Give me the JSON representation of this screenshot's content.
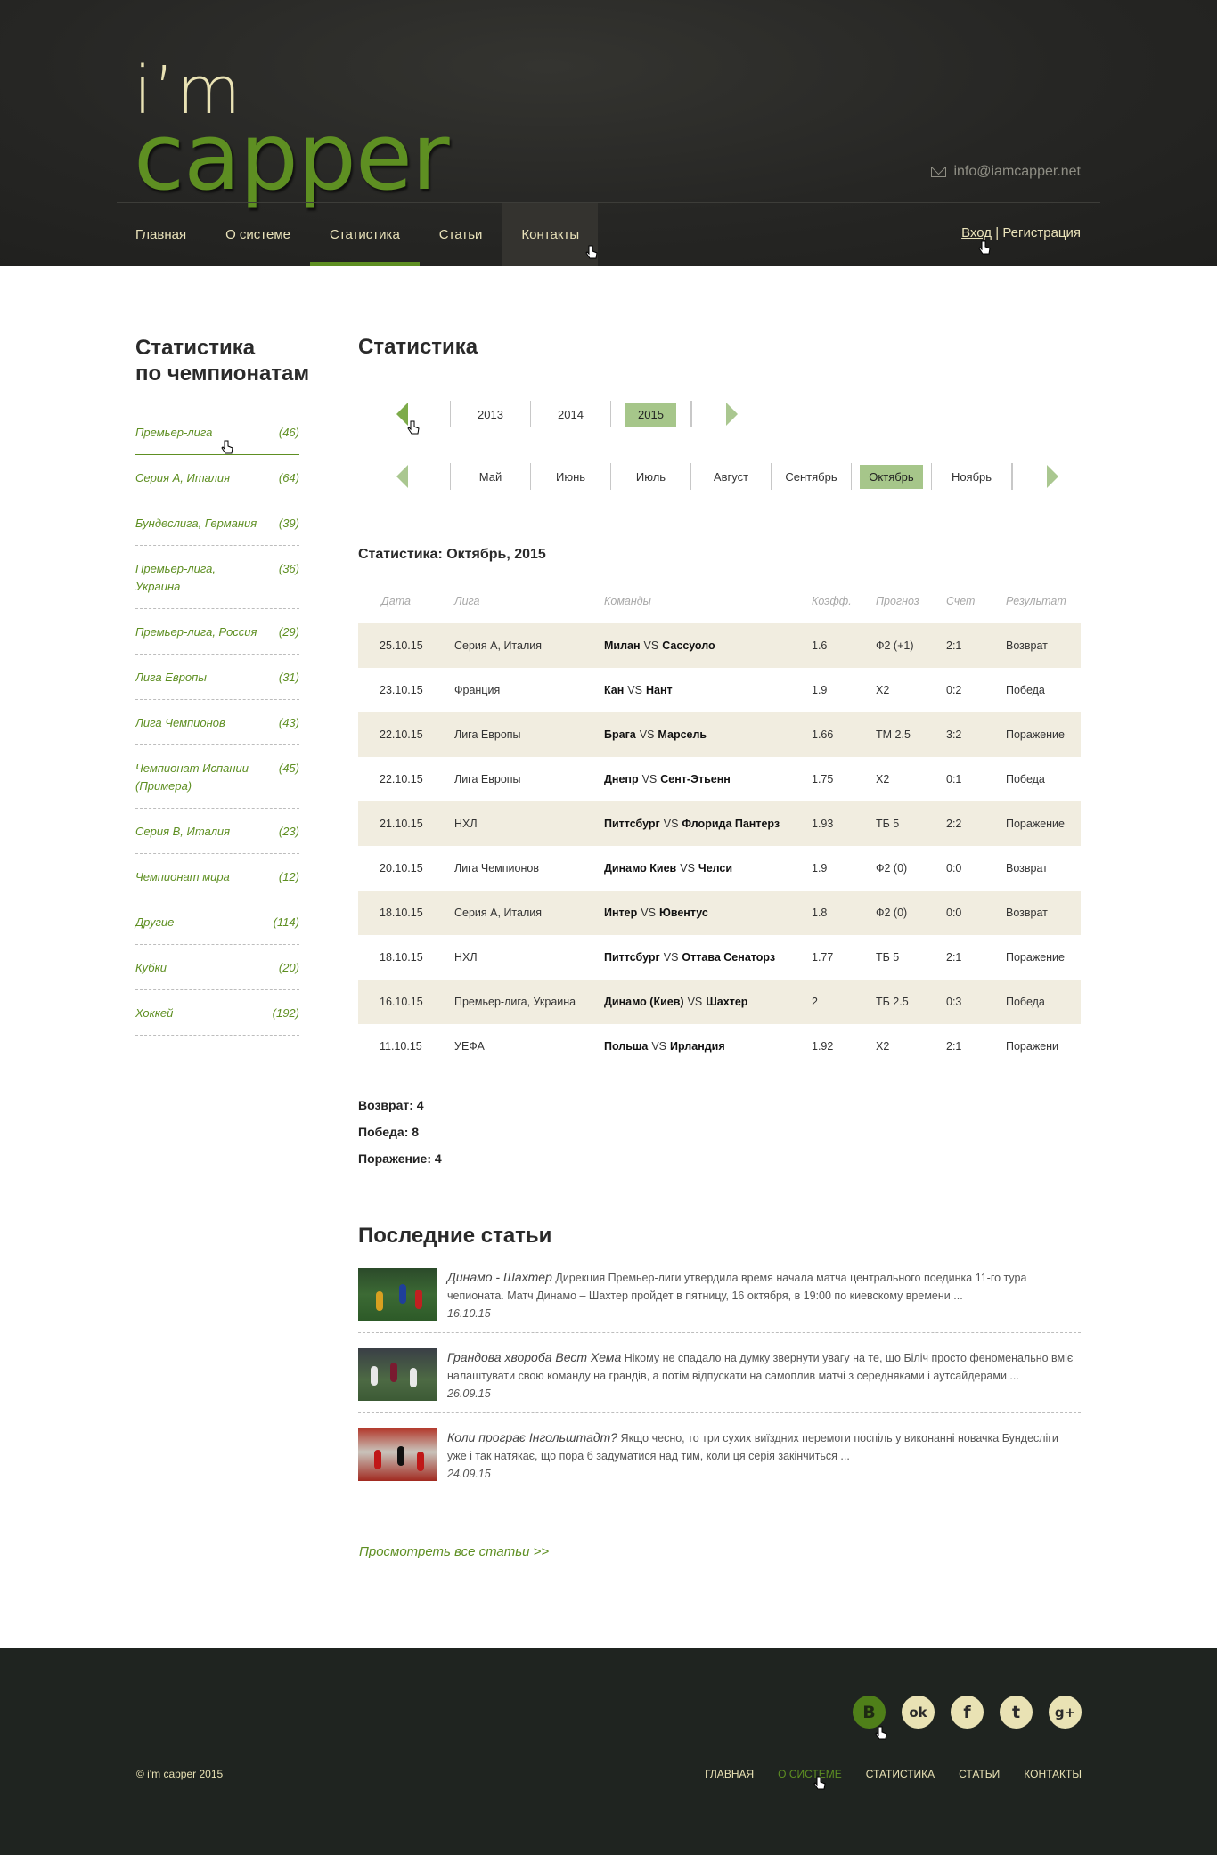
{
  "header": {
    "logo_top": "i’m",
    "logo_bottom": "capper",
    "email": "info@iamcapper.net",
    "nav": [
      "Главная",
      "О системе",
      "Статистика",
      "Статьи",
      "Контакты"
    ],
    "login": "Вход",
    "separator": "|",
    "register": "Регистрация"
  },
  "sidebar": {
    "title_line1": "Статистика",
    "title_line2": "по чемпионатам",
    "items": [
      {
        "name": "Премьер-лига",
        "count": "(46)"
      },
      {
        "name": "Серия А, Италия",
        "count": "(64)"
      },
      {
        "name": "Бундеслига, Германия",
        "count": "(39)"
      },
      {
        "name": "Премьер-лига, Украина",
        "count": "(36)"
      },
      {
        "name": "Премьер-лига, Россия",
        "count": "(29)"
      },
      {
        "name": "Лига Европы",
        "count": "(31)"
      },
      {
        "name": "Лига Чемпионов",
        "count": "(43)"
      },
      {
        "name": "Чемпионат Испании (Примера)",
        "count": "(45)"
      },
      {
        "name": "Серия В, Италия",
        "count": "(23)"
      },
      {
        "name": "Чемпионат мира",
        "count": "(12)"
      },
      {
        "name": "Другие",
        "count": "(114)"
      },
      {
        "name": "Кубки",
        "count": "(20)"
      },
      {
        "name": "Хоккей",
        "count": "(192)"
      }
    ]
  },
  "main": {
    "title": "Статистика",
    "years": [
      "2013",
      "2014",
      "2015"
    ],
    "selected_year": "2015",
    "months": [
      "Май",
      "Июнь",
      "Июль",
      "Август",
      "Сентябрь",
      "Октябрь",
      "Ноябрь"
    ],
    "selected_month": "Октябрь",
    "stat_title": "Статистика: Октябрь, 2015",
    "columns": [
      "Дата",
      "Лига",
      "Команды",
      "Коэфф.",
      "Прогноз",
      "Счет",
      "Результат"
    ],
    "vs": "VS",
    "rows": [
      {
        "date": "25.10.15",
        "league": "Серия А, Италия",
        "team1": "Милан",
        "team2": "Сассуоло",
        "coef": "1.6",
        "forecast": "Ф2 (+1)",
        "score": "2:1",
        "result": "Возврат"
      },
      {
        "date": "23.10.15",
        "league": "Франция",
        "team1": "Кан",
        "team2": "Нант",
        "coef": "1.9",
        "forecast": "Х2",
        "score": "0:2",
        "result": "Победа"
      },
      {
        "date": "22.10.15",
        "league": "Лига Европы",
        "team1": "Брага",
        "team2": "Марсель",
        "coef": "1.66",
        "forecast": "ТМ 2.5",
        "score": "3:2",
        "result": "Поражение"
      },
      {
        "date": "22.10.15",
        "league": "Лига Европы",
        "team1": "Днепр",
        "team2": "Сент-Этьенн",
        "coef": "1.75",
        "forecast": "Х2",
        "score": "0:1",
        "result": "Победа"
      },
      {
        "date": "21.10.15",
        "league": "НХЛ",
        "team1": "Питтсбург",
        "team2": "Флорида Пантерз",
        "coef": "1.93",
        "forecast": "ТБ 5",
        "score": "2:2",
        "result": "Поражение"
      },
      {
        "date": "20.10.15",
        "league": "Лига Чемпионов",
        "team1": "Динамо Киев",
        "team2": "Челси",
        "coef": "1.9",
        "forecast": "Ф2 (0)",
        "score": "0:0",
        "result": "Возврат"
      },
      {
        "date": "18.10.15",
        "league": "Серия А, Италия",
        "team1": "Интер",
        "team2": "Ювентус",
        "coef": "1.8",
        "forecast": "Ф2 (0)",
        "score": "0:0",
        "result": "Возврат"
      },
      {
        "date": "18.10.15",
        "league": "НХЛ",
        "team1": "Питтсбург",
        "team2": "Оттава Сенаторз",
        "coef": "1.77",
        "forecast": "ТБ 5",
        "score": "2:1",
        "result": "Поражение"
      },
      {
        "date": "16.10.15",
        "league": "Премьер-лига, Украина",
        "team1": "Динамо (Киев)",
        "team2": "Шахтер",
        "coef": "2",
        "forecast": "ТБ 2.5",
        "score": "0:3",
        "result": "Победа"
      },
      {
        "date": "11.10.15",
        "league": "УЕФА",
        "team1": "Польша",
        "team2": "Ирландия",
        "coef": "1.92",
        "forecast": "Х2",
        "score": "2:1",
        "result": "Поражени"
      }
    ],
    "totals": [
      "Возврат: 4",
      "Победа: 8",
      "Поражение: 4"
    ],
    "articles_title": "Последние статьи",
    "articles": [
      {
        "title": "Динамо - Шахтер",
        "text": "Дирекция Премьер-лиги утвердила время начала матча центрального поединка 11-го тура чепионата. Матч Динамо – Шахтер пройдет в пятницу, 16 октября, в 19:00 по киевскому времени ...",
        "date": "16.10.15"
      },
      {
        "title": "Грандова хвороба Вест Хема",
        "text": "Нікому не спадало на думку звернути увагу на те, що Біліч просто феноменально вміє налаштувати свою команду на грандів, а потім відпускати на самоплив матчі з середняками і аутсайдерами ...",
        "date": "26.09.15"
      },
      {
        "title": "Коли програє Інгольштадт?",
        "text": "Якщо чесно, то три сухих виїздних перемоги поспіль у виконанні новачка Бундесліги уже і так натякає, що пора б задуматися над тим, коли ця серія закінчиться ...",
        "date": "24.09.15"
      }
    ],
    "all_articles": "Просмотреть все статьи >>"
  },
  "footer": {
    "social": [
      {
        "icon": "vk-icon",
        "glyph": "В"
      },
      {
        "icon": "odnoklassniki-icon",
        "glyph": "ok"
      },
      {
        "icon": "facebook-icon",
        "glyph": "f"
      },
      {
        "icon": "twitter-icon",
        "glyph": "t"
      },
      {
        "icon": "google-plus-icon",
        "glyph": "g+"
      }
    ],
    "copyright": "© i'm capper 2015",
    "nav": [
      "ГЛАВНАЯ",
      "О СИСТЕМЕ",
      "СТАТИСТИКА",
      "СТАТЬИ",
      "КОНТАКТЫ"
    ]
  },
  "colors": {
    "accent": "#5e8f22",
    "cream": "#e9e2b4",
    "row": "#f1ede0",
    "header_bg": "#262624",
    "footer_bg": "#1f2420"
  }
}
